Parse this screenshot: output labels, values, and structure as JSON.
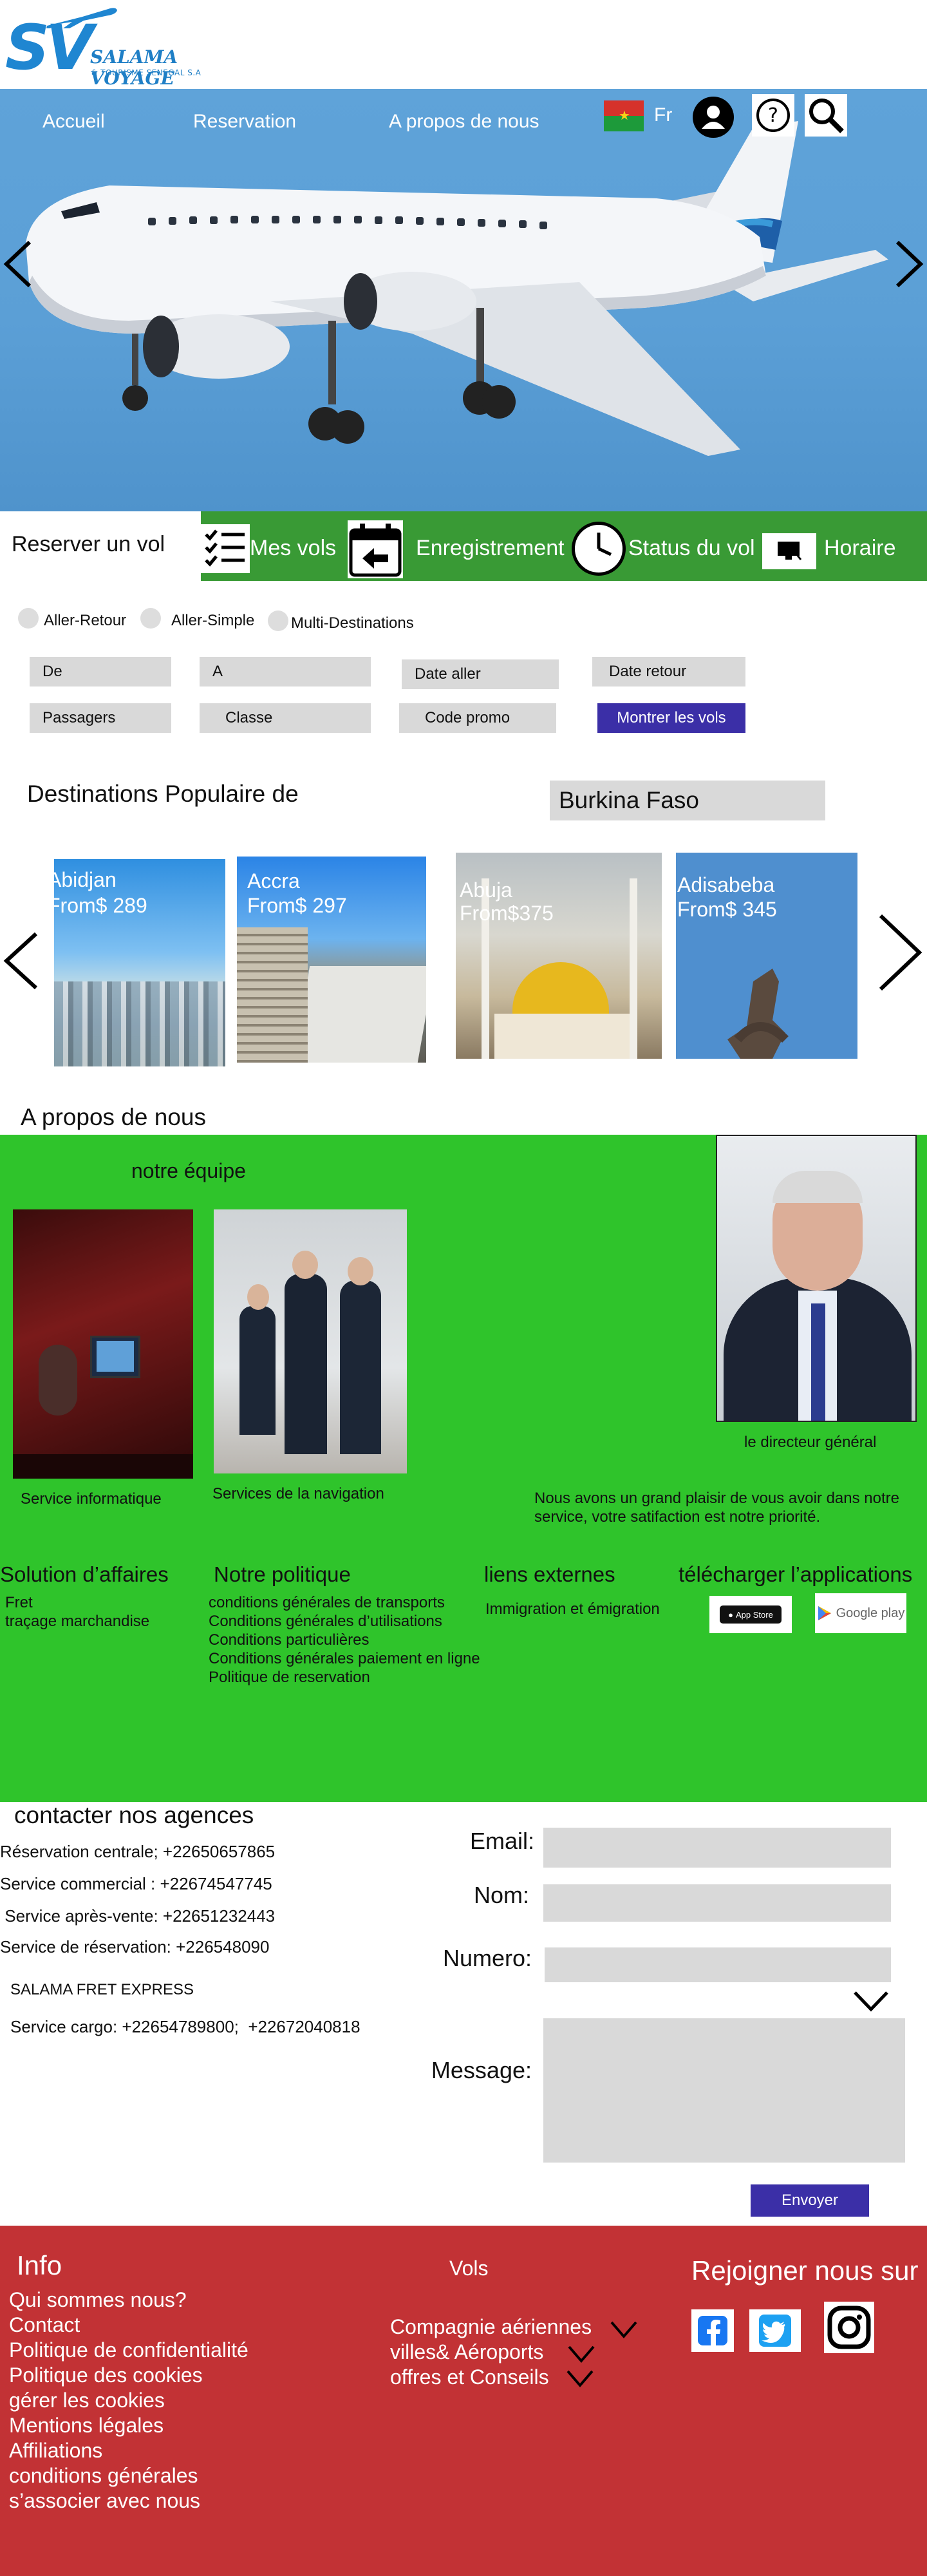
{
  "brand": {
    "logo_initials": "SV",
    "name": "SALAMA VOYAGE",
    "tagline": "& TOURISME SENEGAL S.A"
  },
  "nav": {
    "items": [
      "Accueil",
      "Reservation",
      "A propos de nous"
    ],
    "language": "Fr"
  },
  "booking": {
    "title": "Reserver un vol",
    "tabs": [
      "Mes vols",
      "Enregistrement",
      "Status du vol",
      "Horaire"
    ],
    "trip_types": [
      "Aller-Retour",
      "Aller-Simple",
      "Multi-Destinations"
    ],
    "fields": {
      "from": "De",
      "to": "A",
      "date_out": "Date aller",
      "date_return": "Date retour",
      "passengers": "Passagers",
      "class": "Classe",
      "promo": "Code promo"
    },
    "submit_label": "Montrer les vols"
  },
  "destinations": {
    "heading": "Destinations Populaire de",
    "origin": "Burkina Faso",
    "cards": [
      {
        "city": "Abidjan",
        "price": "From$ 289"
      },
      {
        "city": "Accra",
        "price": "From$ 297"
      },
      {
        "city": "Abuja",
        "price": "From$375"
      },
      {
        "city": "Adisabeba",
        "price": "From$ 345"
      }
    ]
  },
  "about": {
    "heading": "A propos de nous",
    "team_title": "notre équipe",
    "team": [
      "Service informatique",
      "Services de la navigation"
    ],
    "director_caption": "le directeur général",
    "director_quote": "Nous avons un grand plaisir de vous avoir dans notre service, votre satifaction est notre priorité.",
    "columns": {
      "business": {
        "title": "Solution d’affaires",
        "items": [
          "Fret",
          "traçage marchandise"
        ]
      },
      "policy": {
        "title": "Notre politique",
        "items": [
          "conditions générales de transports",
          "Conditions générales d’utilisations",
          "Conditions particulières",
          "Conditions générales paiement en ligne",
          "Politique de reservation"
        ]
      },
      "links": {
        "title": "liens externes",
        "items": [
          "Immigration et émigration"
        ]
      },
      "apps": {
        "title": "télécharger l’applications",
        "app_store": "App Store",
        "google_play": "Google play"
      }
    }
  },
  "contact": {
    "heading": "contacter nos agences",
    "lines": [
      "Réservation centrale; +22650657865",
      "Service commercial : +22674547745",
      " Service après-vente: +22651232443",
      "Service de réservation: +226548090"
    ],
    "fret_title": "SALAMA FRET EXPRESS",
    "cargo": "Service cargo: +22654789800;  +22672040818",
    "form": {
      "email_label": "Email:",
      "name_label": "Nom:",
      "number_label": "Numero:",
      "message_label": "Message:",
      "send_label": "Envoyer"
    }
  },
  "footer": {
    "info_title": "Info",
    "info_links": [
      "Qui sommes nous?",
      "Contact",
      "Politique de confidentialité",
      "Politique des cookies",
      "gérer les cookies",
      "Mentions légales",
      "Affiliations",
      "conditions générales",
      "s’associer avec nous"
    ],
    "vols_title": "Vols",
    "vols_links": [
      "Compagnie aériennes",
      "villes& Aéroports",
      "offres et Conseils"
    ],
    "social_title": "Rejoigner nous sur"
  },
  "colors": {
    "brand_blue": "#1f86d1",
    "sky": "#5b9fd6",
    "booking_green": "#399a35",
    "section_green": "#2fc42b",
    "button_purple": "#3b2fa7",
    "footer_red": "#c23235"
  },
  "icons": [
    "plane-icon",
    "flag-burkina-icon",
    "user-icon",
    "help-icon",
    "search-icon",
    "chevron-left-icon",
    "chevron-right-icon",
    "list-icon",
    "calendar-icon",
    "clock-icon",
    "monitor-icon",
    "chevron-down-icon",
    "facebook-icon",
    "twitter-icon",
    "instagram-icon"
  ]
}
